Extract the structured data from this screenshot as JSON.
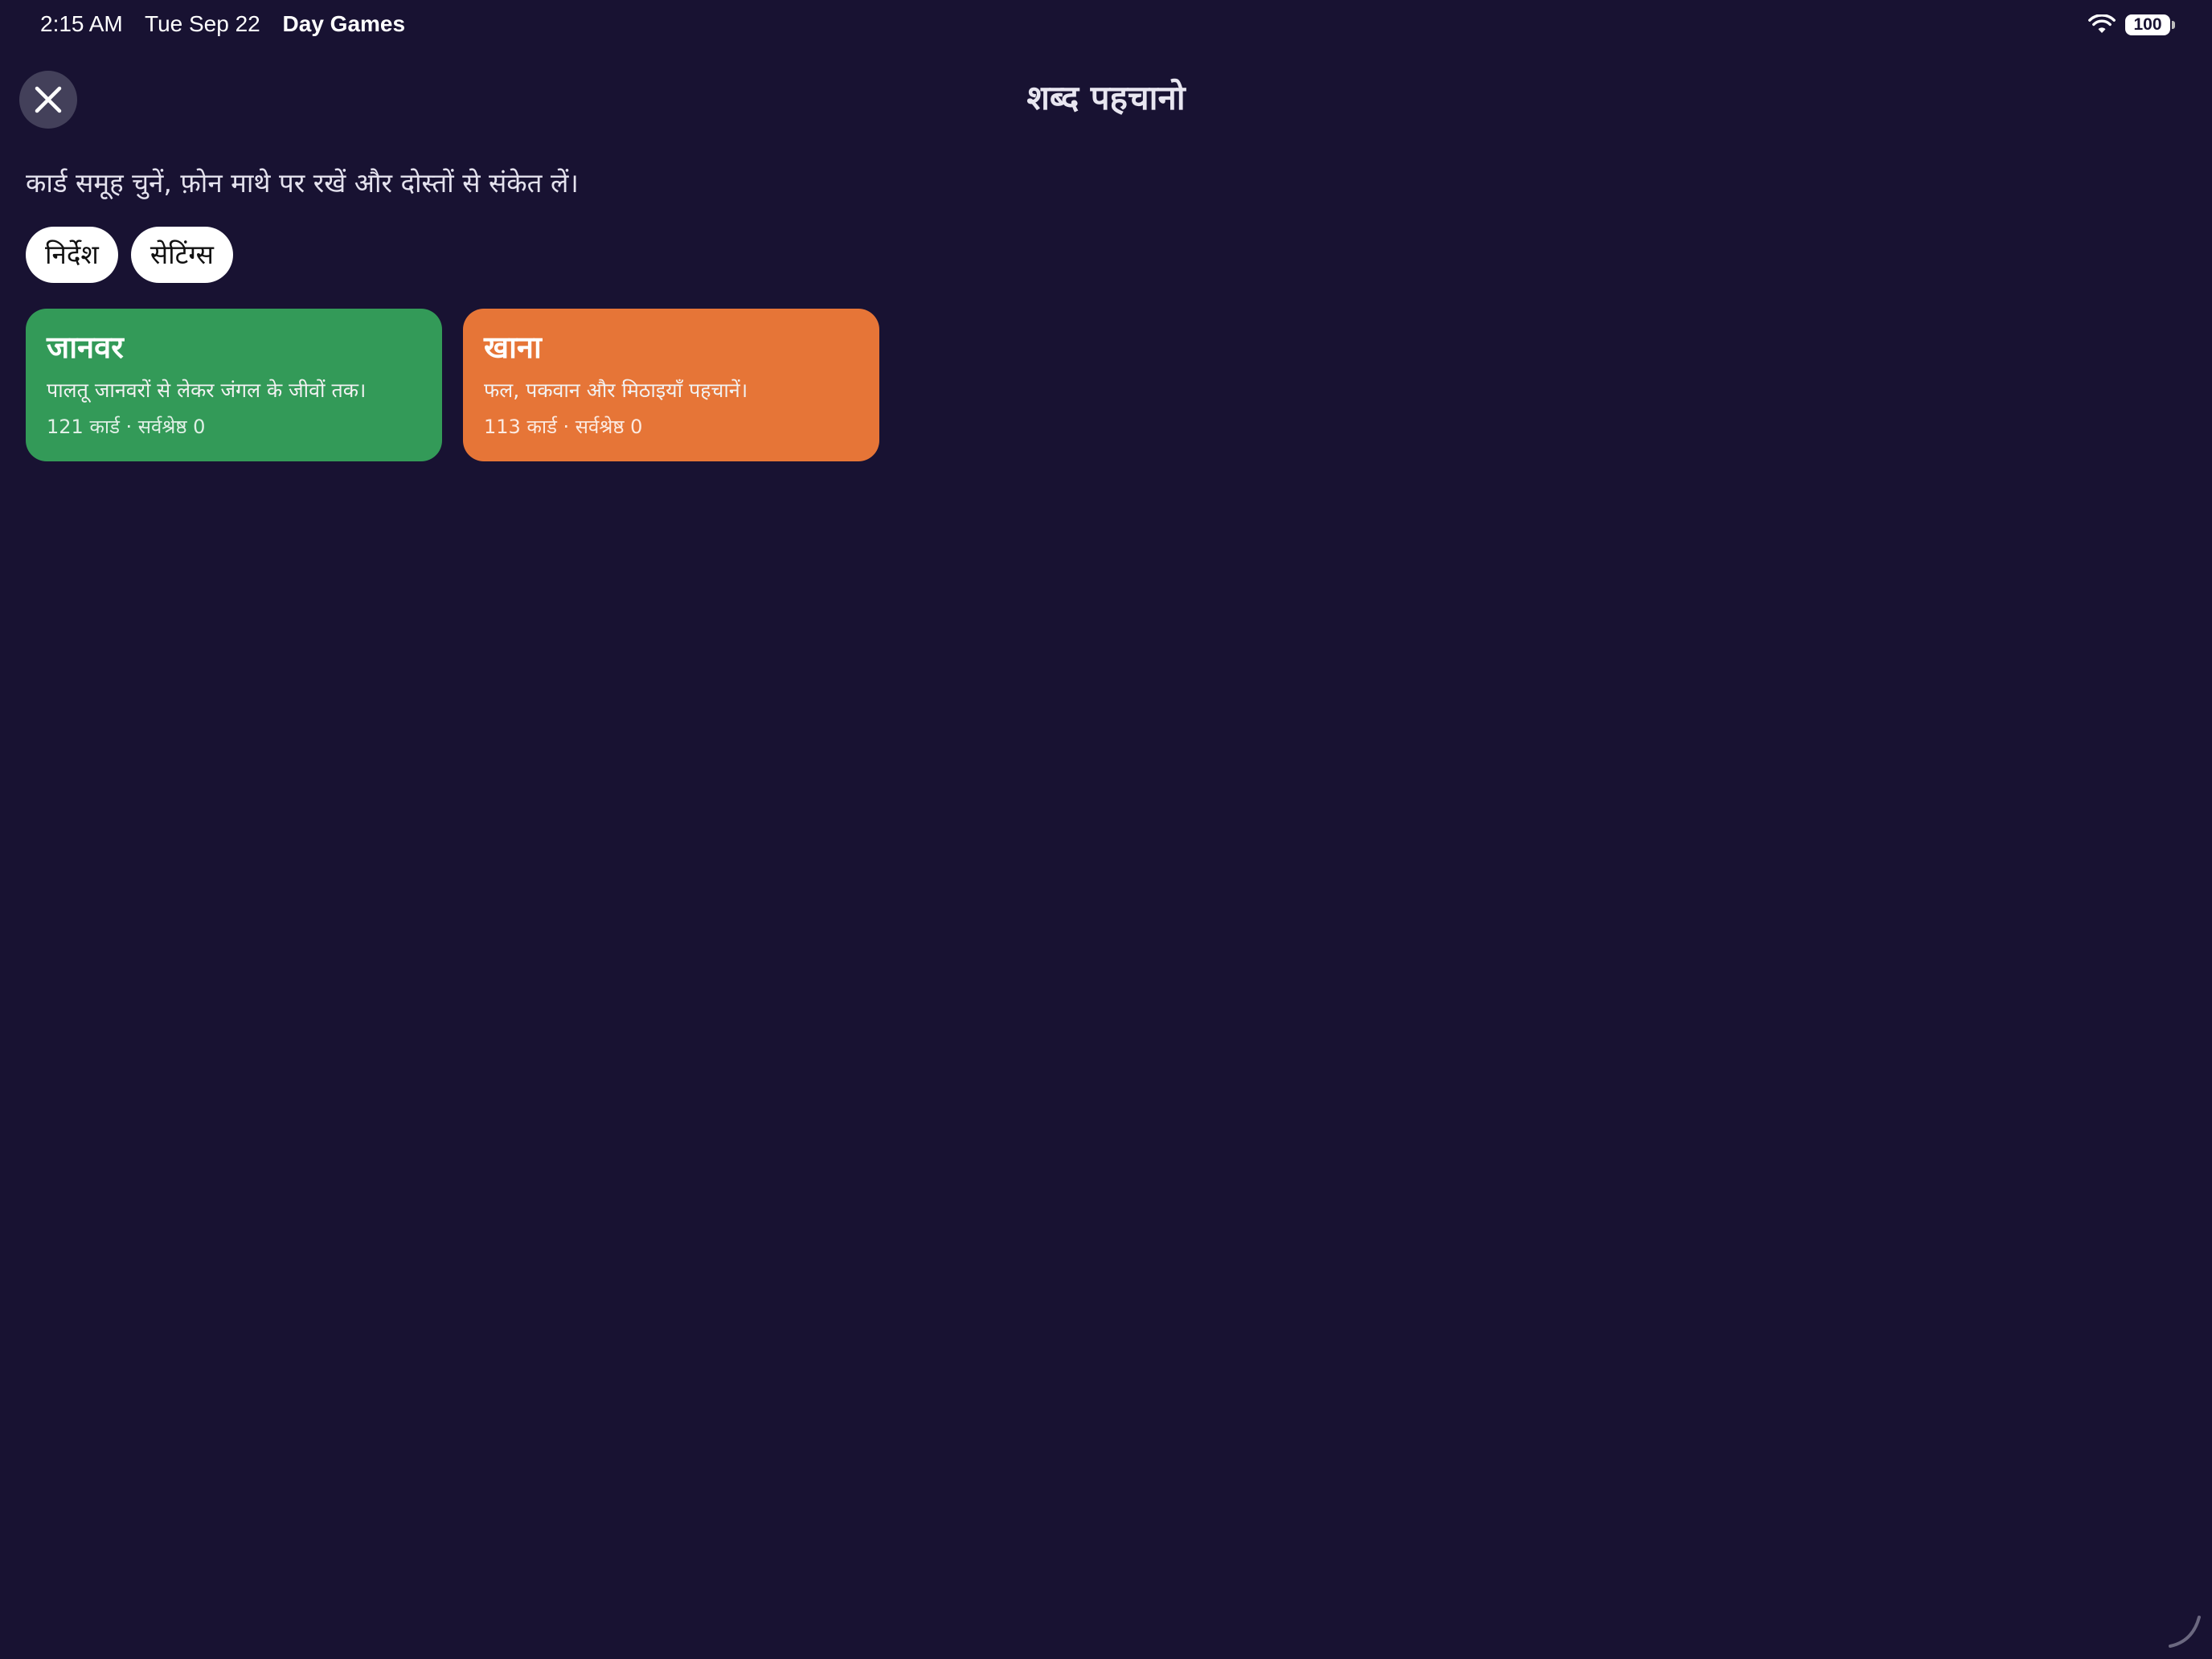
{
  "status_bar": {
    "time": "2:15 AM",
    "date": "Tue Sep 22",
    "app_name": "Day Games",
    "battery": "100",
    "wifi_icon": "wifi-icon"
  },
  "header": {
    "title": "शब्द पहचानो",
    "close_icon": "close-icon"
  },
  "subtitle": "कार्ड समूह चुनें, फ़ोन माथे पर रखें और दोस्तों से संकेत लें।",
  "buttons": {
    "instructions": "निर्देश",
    "settings": "सेटिंग्स"
  },
  "decks": [
    {
      "title": "जानवर",
      "description": "पालतू जानवरों से लेकर जंगल के जीवों तक।",
      "meta": "121 कार्ड · सर्वश्रेष्ठ 0",
      "color": "#339a58"
    },
    {
      "title": "खाना",
      "description": "फल, पकवान और मिठाइयाँ पहचानें।",
      "meta": "113 कार्ड · सर्वश्रेष्ठ 0",
      "color": "#e67537"
    }
  ],
  "colors": {
    "background": "#181232",
    "close_button": "#43405a",
    "pill": "#ffffff"
  }
}
